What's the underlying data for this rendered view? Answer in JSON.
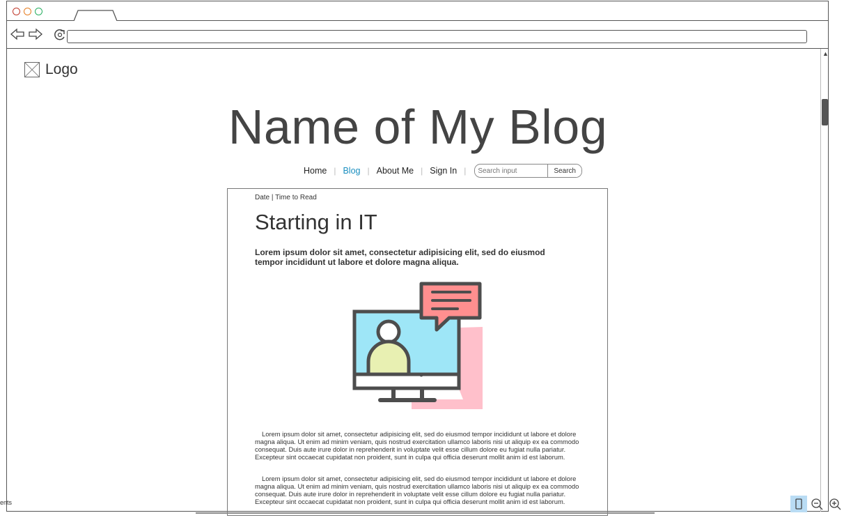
{
  "browser": {
    "back_icon": "arrow-left-icon",
    "forward_icon": "arrow-right-icon",
    "reload_icon": "reload-icon",
    "url": ""
  },
  "site": {
    "logo_label": "Logo",
    "blog_title": "Name of My Blog"
  },
  "menu": {
    "items": [
      {
        "label": "Home",
        "active": false
      },
      {
        "label": "Blog",
        "active": true
      },
      {
        "label": "About Me",
        "active": false
      },
      {
        "label": "Sign In",
        "active": false
      }
    ],
    "search_placeholder": "Search input",
    "search_button": "Search",
    "active_color": "#1a8fc0"
  },
  "article": {
    "meta": "Date | Time to Read",
    "title": "Starting in IT",
    "lead": "Lorem ipsum dolor sit amet, consectetur adipisicing elit, sed do eiusmod tempor incididunt ut labore et dolore magna aliqua.",
    "paragraphs": [
      "Lorem ipsum dolor sit amet, consectetur adipisicing elit, sed do eiusmod tempor incididunt ut labore et dolore magna aliqua. Ut enim ad minim veniam, quis nostrud exercitation ullamco laboris nisi ut aliquip ex ea commodo consequat. Duis aute irure dolor in reprehenderit in voluptate velit esse cillum dolore eu fugiat nulla pariatur. Excepteur sint occaecat cupidatat non proident, sunt in culpa qui officia deserunt mollit anim id est laborum.",
      "Lorem ipsum dolor sit amet, consectetur adipisicing elit, sed do eiusmod tempor incididunt ut labore et dolore magna aliqua. Ut enim ad minim veniam, quis nostrud exercitation ullamco laboris nisi ut aliquip ex ea commodo consequat. Duis aute irure dolor in reprehenderit in voluptate velit esse cillum dolore eu fugiat nulla pariatur. Excepteur sint occaecat cupidatat non proident, sunt in culpa qui officia deserunt mollit anim id est laborum."
    ],
    "illustration": "video-call-icon"
  },
  "footer": {
    "left_text": "ents"
  }
}
